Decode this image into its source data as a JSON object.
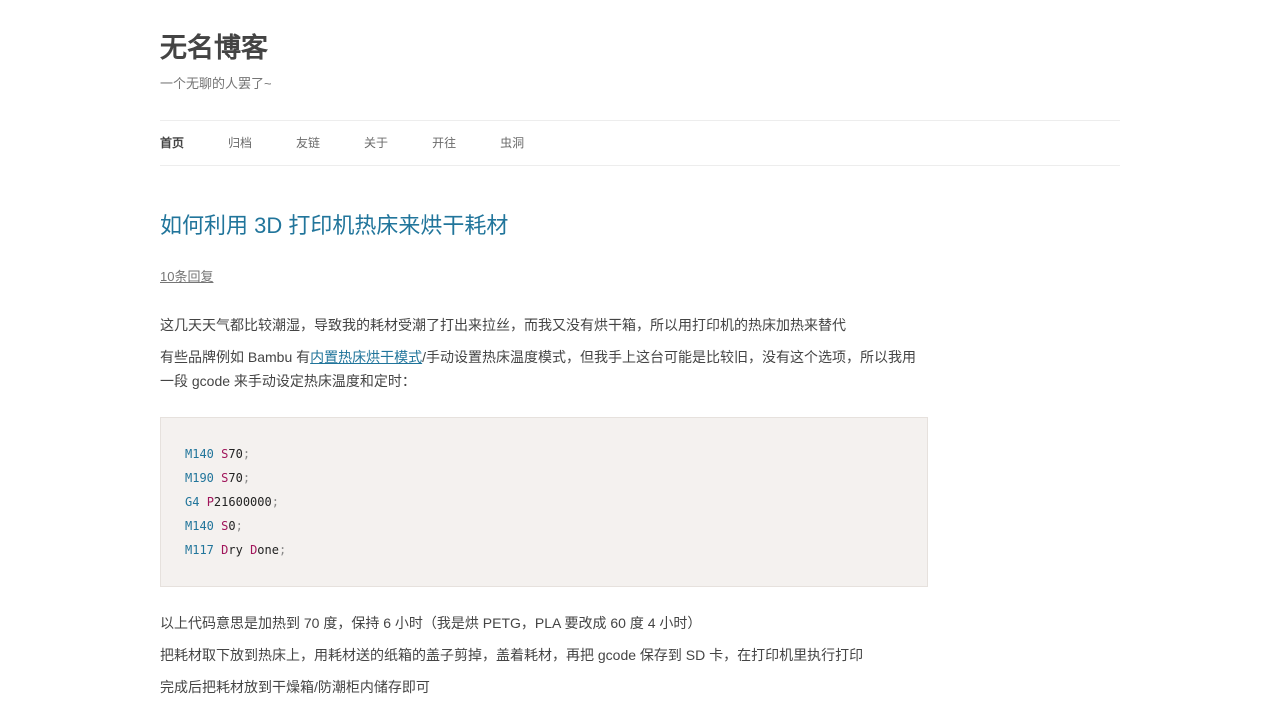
{
  "site": {
    "title": "无名博客",
    "tagline": "一个无聊的人罢了~"
  },
  "nav": {
    "items": [
      {
        "label": "首页",
        "active": true
      },
      {
        "label": "归档"
      },
      {
        "label": "友链"
      },
      {
        "label": "关于"
      },
      {
        "label": "开往"
      },
      {
        "label": "虫洞"
      }
    ]
  },
  "post": {
    "title": "如何利用 3D 打印机热床来烘干耗材",
    "comments_link": "10条回复",
    "para1": "这几天天气都比较潮湿，导致我的耗材受潮了打出来拉丝，而我又没有烘干箱，所以用打印机的热床加热来替代",
    "para2_before": "有些品牌例如 Bambu 有",
    "para2_link": "内置热床烘干模式",
    "para2_after": "/手动设置热床温度模式，但我手上这台可能是比较旧，没有这个选项，所以我用一段 gcode 来手动设定热床温度和定时：",
    "code": [
      {
        "cmd": "M140",
        "p1": "S",
        "v1": "70",
        "p2": "",
        "v2": "",
        "sc": ";"
      },
      {
        "cmd": "M190",
        "p1": "S",
        "v1": "70",
        "p2": "",
        "v2": "",
        "sc": ";"
      },
      {
        "cmd": "G4",
        "p1": "P",
        "v1": "21600000",
        "p2": "",
        "v2": "",
        "sc": ";"
      },
      {
        "cmd": "M140",
        "p1": "S",
        "v1": "0",
        "p2": "",
        "v2": "",
        "sc": ";"
      },
      {
        "cmd": "M117",
        "p1": "D",
        "v1": "ry ",
        "p2": "D",
        "v2": "one",
        "sc": ";"
      }
    ],
    "para3": "以上代码意思是加热到 70 度，保持 6 小时（我是烘 PETG，PLA 要改成 60 度 4 小时）",
    "para4": "把耗材取下放到热床上，用耗材送的纸箱的盖子剪掉，盖着耗材，再把 gcode 保存到 SD 卡，在打印机里执行打印",
    "para5": "完成后把耗材放到干燥箱/防潮柜内储存即可"
  }
}
